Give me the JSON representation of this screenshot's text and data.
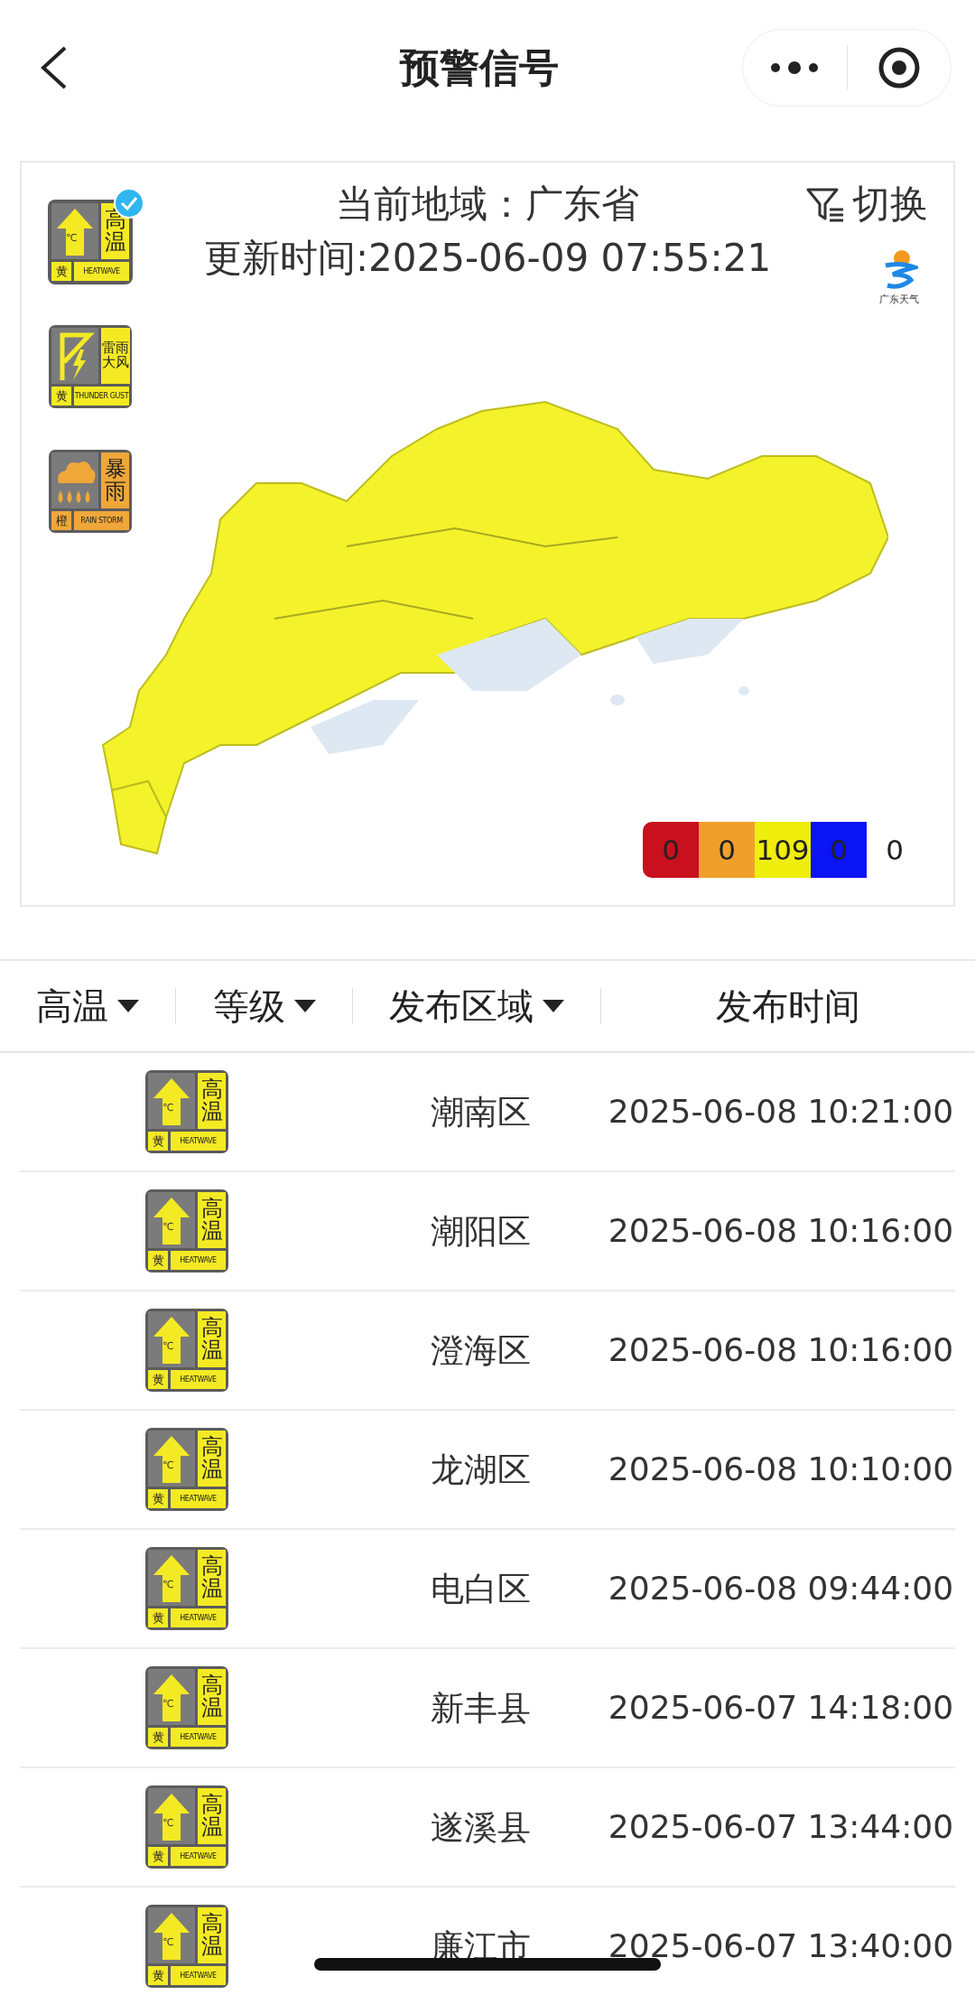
{
  "nav": {
    "title": "预警信号"
  },
  "region": {
    "label": "当前地域：广东省",
    "updated": "更新时间:2025-06-09 07:55:21",
    "switch": "切换",
    "logo_caption": "广东天气"
  },
  "signals": [
    {
      "kind": "heat",
      "title": "高温",
      "level_label": "黄",
      "english": "HEATWAVE",
      "color": "#f4ea24",
      "glyph": "℃",
      "selected": true
    },
    {
      "kind": "thunder",
      "title": "雷雨大风",
      "level_label": "黄",
      "english": "THUNDER GUST",
      "color": "#f4ea24",
      "selected": false
    },
    {
      "kind": "rain",
      "title": "暴雨",
      "level_label": "橙",
      "english": "RAIN STORM",
      "color": "#f0a73a",
      "selected": false
    }
  ],
  "legend": [
    {
      "count": "0",
      "color": "#c8101e"
    },
    {
      "count": "0",
      "color": "#f0a02a"
    },
    {
      "count": "109",
      "color": "#f0ee0c"
    },
    {
      "count": "0",
      "color": "#0a14f4"
    },
    {
      "count": "0",
      "color": "#ffffff"
    }
  ],
  "table": {
    "columns": [
      {
        "label": "高温",
        "dropdown": true
      },
      {
        "label": "等级",
        "dropdown": true
      },
      {
        "label": "发布区域",
        "dropdown": true
      },
      {
        "label": "发布时间",
        "dropdown": false
      }
    ],
    "rows": [
      {
        "signal": {
          "kind": "heat",
          "title": "高温",
          "level_label": "黄",
          "english": "HEATWAVE",
          "color": "#f4ea24",
          "glyph": "℃"
        },
        "area": "潮南区",
        "time": "2025-06-08 10:21:00"
      },
      {
        "signal": {
          "kind": "heat",
          "title": "高温",
          "level_label": "黄",
          "english": "HEATWAVE",
          "color": "#f4ea24",
          "glyph": "℃"
        },
        "area": "潮阳区",
        "time": "2025-06-08 10:16:00"
      },
      {
        "signal": {
          "kind": "heat",
          "title": "高温",
          "level_label": "黄",
          "english": "HEATWAVE",
          "color": "#f4ea24",
          "glyph": "℃"
        },
        "area": "澄海区",
        "time": "2025-06-08 10:16:00"
      },
      {
        "signal": {
          "kind": "heat",
          "title": "高温",
          "level_label": "黄",
          "english": "HEATWAVE",
          "color": "#f4ea24",
          "glyph": "℃"
        },
        "area": "龙湖区",
        "time": "2025-06-08 10:10:00"
      },
      {
        "signal": {
          "kind": "heat",
          "title": "高温",
          "level_label": "黄",
          "english": "HEATWAVE",
          "color": "#f4ea24",
          "glyph": "℃"
        },
        "area": "电白区",
        "time": "2025-06-08 09:44:00"
      },
      {
        "signal": {
          "kind": "heat",
          "title": "高温",
          "level_label": "黄",
          "english": "HEATWAVE",
          "color": "#f4ea24",
          "glyph": "℃"
        },
        "area": "新丰县",
        "time": "2025-06-07 14:18:00"
      },
      {
        "signal": {
          "kind": "heat",
          "title": "高温",
          "level_label": "黄",
          "english": "HEATWAVE",
          "color": "#f4ea24",
          "glyph": "℃"
        },
        "area": "遂溪县",
        "time": "2025-06-07 13:44:00"
      },
      {
        "signal": {
          "kind": "heat",
          "title": "高温",
          "level_label": "黄",
          "english": "HEATWAVE",
          "color": "#f4ea24",
          "glyph": "℃"
        },
        "area": "廉江市",
        "time": "2025-06-07 13:40:00"
      }
    ]
  }
}
